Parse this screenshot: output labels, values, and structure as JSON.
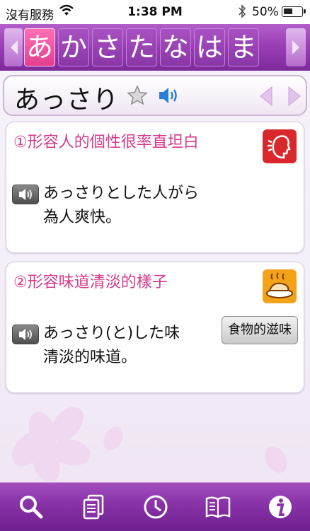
{
  "status_bar": {
    "carrier": "沒有服務",
    "time": "1:38 PM",
    "battery": "50%",
    "battery_level": 0.5
  },
  "kana_nav": {
    "items": [
      "あ",
      "か",
      "さ",
      "た",
      "な",
      "は",
      "ま"
    ],
    "selected": "あ"
  },
  "entry": {
    "headword": "あっさり",
    "senses": [
      {
        "title": "①形容人的個性很率直坦白",
        "icon": "face-speaking-icon",
        "example_lines": [
          "あっさりとした人がら",
          "為人爽快。"
        ]
      },
      {
        "title": "②形容味道清淡的樣子",
        "icon": "roast-chicken-icon",
        "example_lines": [
          "あっさり(と)した味",
          "清淡的味道。"
        ],
        "tag": "食物的滋味"
      }
    ]
  },
  "toolbar": {
    "items": [
      "search-icon",
      "cards-icon",
      "history-clock-icon",
      "notebook-icon",
      "info-icon"
    ]
  },
  "colors": {
    "accent_purple": "#8a34a9",
    "selected_pink": "#e23f8f",
    "sense_title": "#d43a8c",
    "speaker_blue": "#2a7fd6"
  }
}
